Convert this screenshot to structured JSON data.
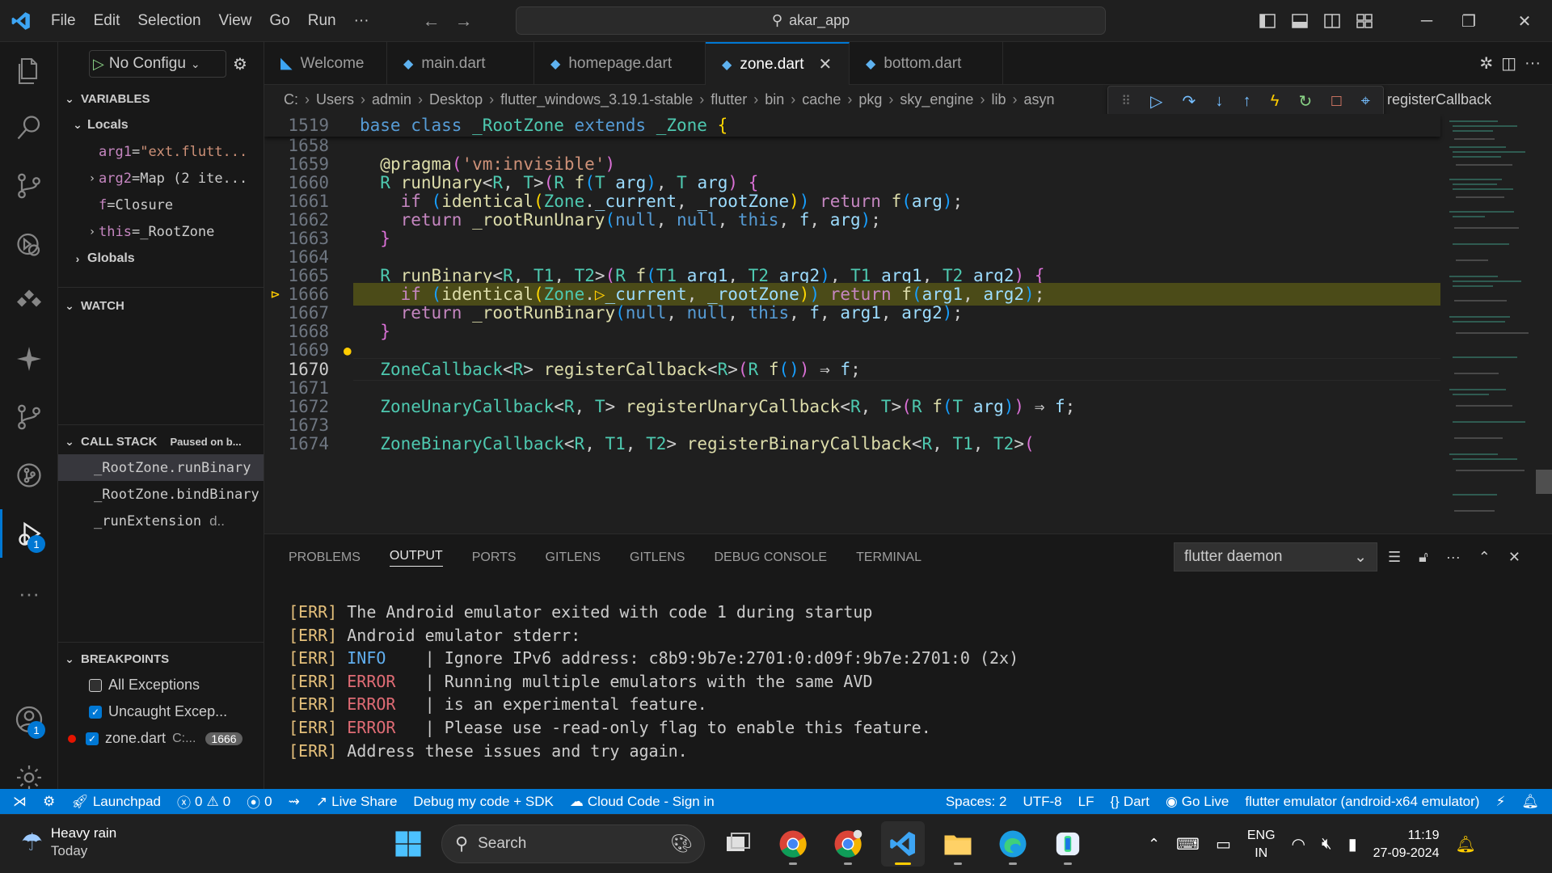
{
  "titlebar": {
    "menu": [
      "File",
      "Edit",
      "Selection",
      "View",
      "Go",
      "Run",
      "···"
    ],
    "search_text": "akar_app"
  },
  "sidebar": {
    "run_config": "No Configu",
    "variables_title": "VARIABLES",
    "locals_title": "Locals",
    "globals_title": "Globals",
    "locals": [
      {
        "name": "arg1",
        "eq": " = ",
        "value": "\"ext.flutt...",
        "kind": "string"
      },
      {
        "name": "arg2",
        "eq": " = ",
        "value": "Map (2 ite...",
        "kind": "obj"
      },
      {
        "name": "f",
        "eq": " = ",
        "value": "Closure",
        "kind": "obj"
      },
      {
        "name": "this",
        "eq": " = ",
        "value": "_RootZone",
        "kind": "obj"
      }
    ],
    "watch_title": "WATCH",
    "callstack_title": "CALL STACK",
    "callstack_status": "Paused on b...",
    "callstack": [
      {
        "name": "_RootZone.runBinary",
        "extra": ""
      },
      {
        "name": "_RootZone.bindBinary",
        "extra": ""
      },
      {
        "name": "_runExtension",
        "extra": "d.."
      }
    ],
    "breakpoints_title": "BREAKPOINTS",
    "breakpoints": [
      {
        "label": "All Exceptions",
        "checked": false,
        "extra": "",
        "count": ""
      },
      {
        "label": "Uncaught Excep...",
        "checked": true,
        "extra": "",
        "count": ""
      },
      {
        "label": "zone.dart",
        "checked": true,
        "extra": "C:...",
        "count": "1666"
      }
    ]
  },
  "activity_badges": {
    "debug": "1",
    "accounts": "1"
  },
  "tabs": [
    {
      "label": "Welcome",
      "active": false,
      "icon": "vscode"
    },
    {
      "label": "main.dart",
      "active": false,
      "icon": "dart"
    },
    {
      "label": "homepage.dart",
      "active": false,
      "icon": "dart"
    },
    {
      "label": "zone.dart",
      "active": true,
      "icon": "dart"
    },
    {
      "label": "bottom.dart",
      "active": false,
      "icon": "dart"
    }
  ],
  "breadcrumb": [
    "C:",
    "Users",
    "admin",
    "Desktop",
    "flutter_windows_3.19.1-stable",
    "flutter",
    "bin",
    "cache",
    "pkg",
    "sky_engine",
    "lib",
    "asyn"
  ],
  "breadcrumb_tail": "registerCallback",
  "editor": {
    "sticky_line": "1519",
    "lines": [
      "1658",
      "1659",
      "1660",
      "1661",
      "1662",
      "1663",
      "1664",
      "1665",
      "1666",
      "1667",
      "1668",
      "1669",
      "1670",
      "1671",
      "1672",
      "1673",
      "1674"
    ],
    "current_line": "1670",
    "paused_line": "1666"
  },
  "panel": {
    "tabs": [
      "PROBLEMS",
      "OUTPUT",
      "PORTS",
      "GITLENS",
      "GITLENS",
      "DEBUG CONSOLE",
      "TERMINAL"
    ],
    "active_tab": "OUTPUT",
    "output_channel": "flutter daemon",
    "output": [
      {
        "tag": "[ERR]",
        "level": "",
        "sep": "",
        "text": " The Android emulator exited with code 1 during startup"
      },
      {
        "tag": "[ERR]",
        "level": "",
        "sep": "",
        "text": " Android emulator stderr:"
      },
      {
        "tag": "[ERR]",
        "level": " INFO ",
        "sep": "   | ",
        "text": "Ignore IPv6 address: c8b9:9b7e:2701:0:d09f:9b7e:2701:0 (2x)"
      },
      {
        "tag": "[ERR]",
        "level": " ERROR",
        "sep": "   | ",
        "text": "Running multiple emulators with the same AVD"
      },
      {
        "tag": "[ERR]",
        "level": " ERROR",
        "sep": "   | ",
        "text": "is an experimental feature."
      },
      {
        "tag": "[ERR]",
        "level": " ERROR",
        "sep": "   | ",
        "text": "Please use -read-only flag to enable this feature."
      },
      {
        "tag": "[ERR]",
        "level": "",
        "sep": "",
        "text": " Address these issues and try again."
      }
    ]
  },
  "statusbar": {
    "launchpad": "Launchpad",
    "errors": "0",
    "warnings": "0",
    "ports": "0",
    "liveshare": "Live Share",
    "debug_mode": "Debug my code + SDK",
    "cloud_code": "Cloud Code - Sign in",
    "spaces": "Spaces: 2",
    "encoding": "UTF-8",
    "eol": "LF",
    "language": "Dart",
    "golive": "Go Live",
    "device": "flutter emulator (android-x64 emulator)"
  },
  "taskbar": {
    "weather_title": "Heavy rain",
    "weather_sub": "Today",
    "search": "Search",
    "lang_top": "ENG",
    "lang_bottom": "IN",
    "time": "11:19",
    "date": "27-09-2024"
  },
  "colors": {
    "accent": "#0078d4",
    "status_bar": "#0078d4",
    "highlight_line": "#4b4b18"
  }
}
